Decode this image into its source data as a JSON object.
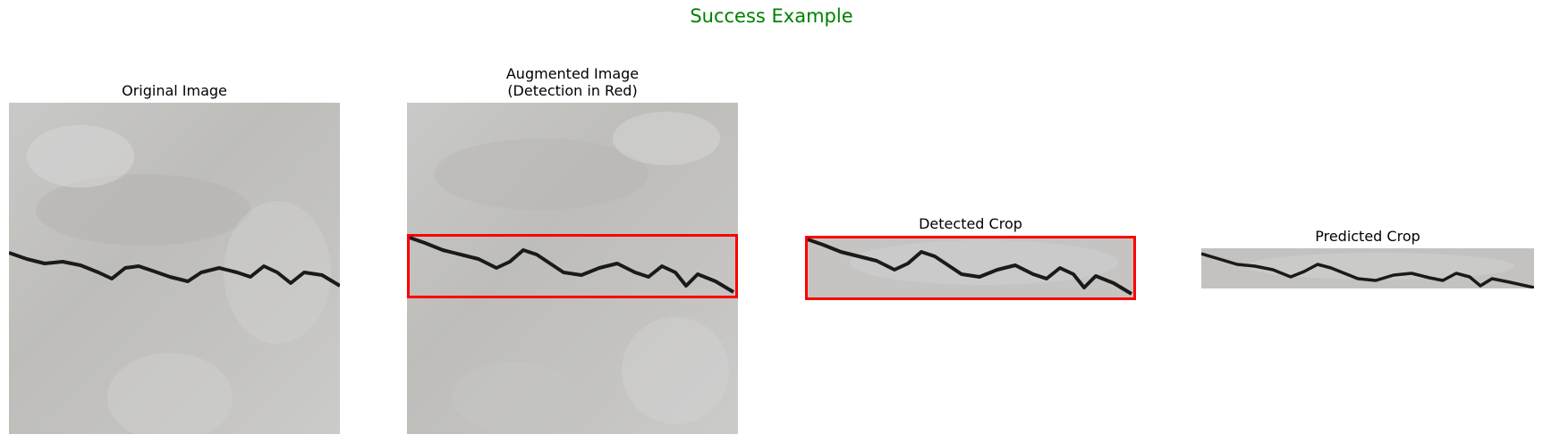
{
  "figure": {
    "suptitle": "Success Example",
    "suptitle_color": "#008000",
    "detection_color": "#ff0000"
  },
  "panels": [
    {
      "title": "Original Image"
    },
    {
      "title": "Augmented Image\n(Detection in Red)"
    },
    {
      "title": "Detected Crop"
    },
    {
      "title": "Predicted Crop"
    }
  ]
}
